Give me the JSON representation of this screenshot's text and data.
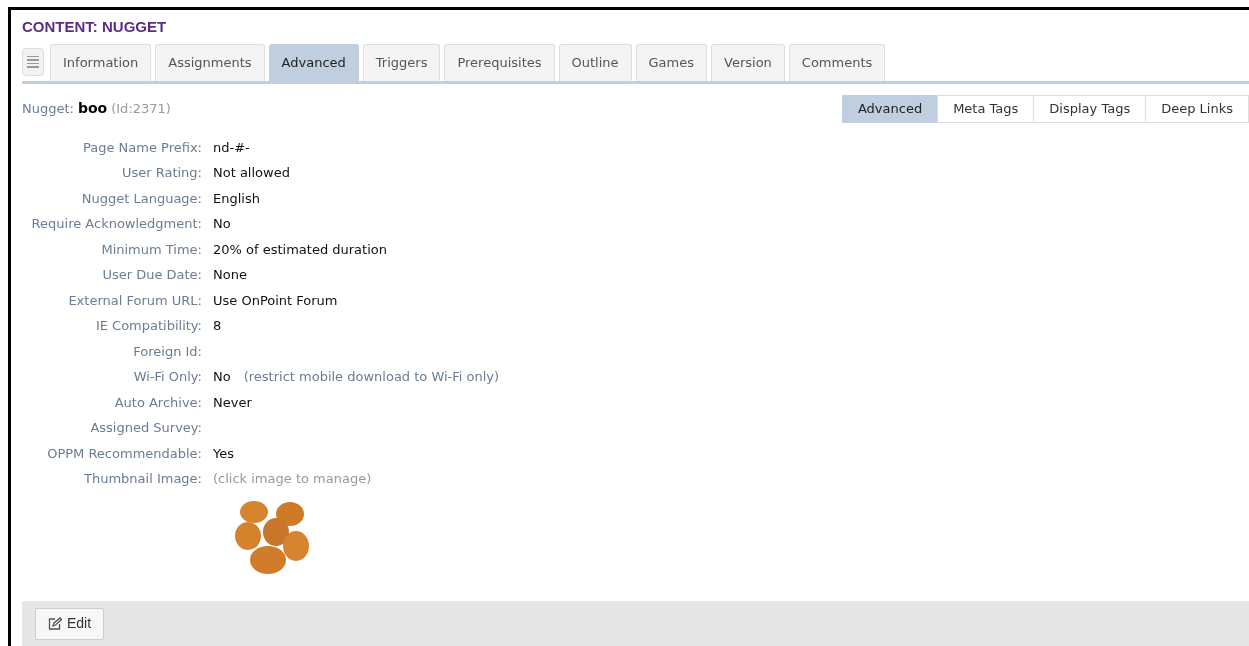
{
  "title": "CONTENT: NUGGET",
  "tabs": [
    {
      "label": "Information",
      "selected": false
    },
    {
      "label": "Assignments",
      "selected": false
    },
    {
      "label": "Advanced",
      "selected": true
    },
    {
      "label": "Triggers",
      "selected": false
    },
    {
      "label": "Prerequisites",
      "selected": false
    },
    {
      "label": "Outline",
      "selected": false
    },
    {
      "label": "Games",
      "selected": false
    },
    {
      "label": "Version",
      "selected": false
    },
    {
      "label": "Comments",
      "selected": false
    }
  ],
  "nugget": {
    "label": "Nugget:",
    "name": "boo",
    "id": "(Id:2371)"
  },
  "subtabs": [
    {
      "label": "Advanced",
      "selected": true
    },
    {
      "label": "Meta Tags",
      "selected": false
    },
    {
      "label": "Display Tags",
      "selected": false
    },
    {
      "label": "Deep Links",
      "selected": false
    }
  ],
  "fields": [
    {
      "label": "Page Name Prefix:",
      "value": "nd-#-"
    },
    {
      "label": "User Rating:",
      "value": "Not allowed"
    },
    {
      "label": "Nugget Language:",
      "value": "English"
    },
    {
      "label": "Require Acknowledgment:",
      "value": "No"
    },
    {
      "label": "Minimum Time:",
      "value": "20% of estimated duration"
    },
    {
      "label": "User Due Date:",
      "value": "None"
    },
    {
      "label": "External Forum URL:",
      "value": "Use OnPoint Forum"
    },
    {
      "label": "IE Compatibility:",
      "value": "8"
    },
    {
      "label": "Foreign Id:"
    },
    {
      "label": "Wi-Fi Only:",
      "value": "No",
      "note": "(restrict mobile download to Wi-Fi only)"
    },
    {
      "label": "Auto Archive:",
      "value": "Never"
    },
    {
      "label": "Assigned Survey:"
    },
    {
      "label": "OPPM Recommendable:",
      "value": "Yes"
    },
    {
      "label": "Thumbnail Image:",
      "hint": "(click image to manage)"
    }
  ],
  "edit_button": "Edit"
}
